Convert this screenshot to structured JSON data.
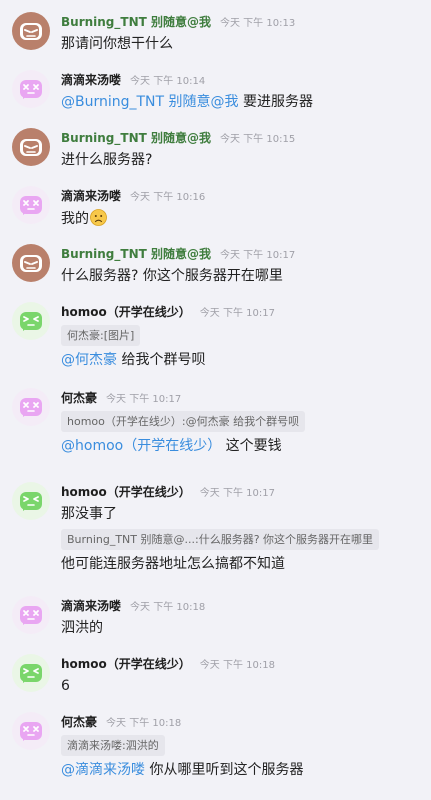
{
  "colors": {
    "name_green": "#3f7d3e",
    "name_dark": "#1f1f1f",
    "mention_blue": "#3a8dde",
    "avatar_brown": "#b9806b",
    "avatar_pink": "#e9a6f2",
    "avatar_green": "#7ad66b"
  },
  "messages": [
    {
      "sender": "Burning_TNT 别随意@我",
      "time": "今天 下午 10:13",
      "text": "那请问你想干什么"
    },
    {
      "sender": "滴滴来汤喽",
      "time": "今天 下午 10:14",
      "mention": "@Burning_TNT 别随意@我",
      "text": "要进服务器"
    },
    {
      "sender": "Burning_TNT 别随意@我",
      "time": "今天 下午 10:15",
      "text": "进什么服务器?"
    },
    {
      "sender": "滴滴来汤喽",
      "time": "今天 下午 10:16",
      "text": "我的",
      "emoji": "sad-face-emoji"
    },
    {
      "sender": "Burning_TNT 别随意@我",
      "time": "今天 下午 10:17",
      "text": "什么服务器? 你这个服务器开在哪里"
    },
    {
      "sender": "homoo（开学在线少）",
      "time": "今天 下午 10:17",
      "quote": "何杰豪:[图片]",
      "mention": "@何杰豪",
      "text": "给我个群号呗"
    },
    {
      "sender": "何杰豪",
      "time": "今天 下午 10:17",
      "quote": "homoo（开学在线少）:@何杰豪 给我个群号呗",
      "mention": "@homoo（开学在线少）",
      "text": "这个要钱"
    },
    {
      "sender": "homoo（开学在线少）",
      "time": "今天 下午 10:17",
      "text": "那没事了",
      "quote": "Burning_TNT 别随意@...:什么服务器? 你这个服务器开在哪里",
      "text2": "他可能连服务器地址怎么搞都不知道"
    },
    {
      "sender": "滴滴来汤喽",
      "time": "今天 下午 10:18",
      "text": "泗洪的"
    },
    {
      "sender": "homoo（开学在线少）",
      "time": "今天 下午 10:18",
      "text": "6"
    },
    {
      "sender": "何杰豪",
      "time": "今天 下午 10:18",
      "quote": "滴滴来汤喽:泗洪的",
      "mention": "@滴滴来汤喽",
      "text": "你从哪里听到这个服务器"
    }
  ]
}
